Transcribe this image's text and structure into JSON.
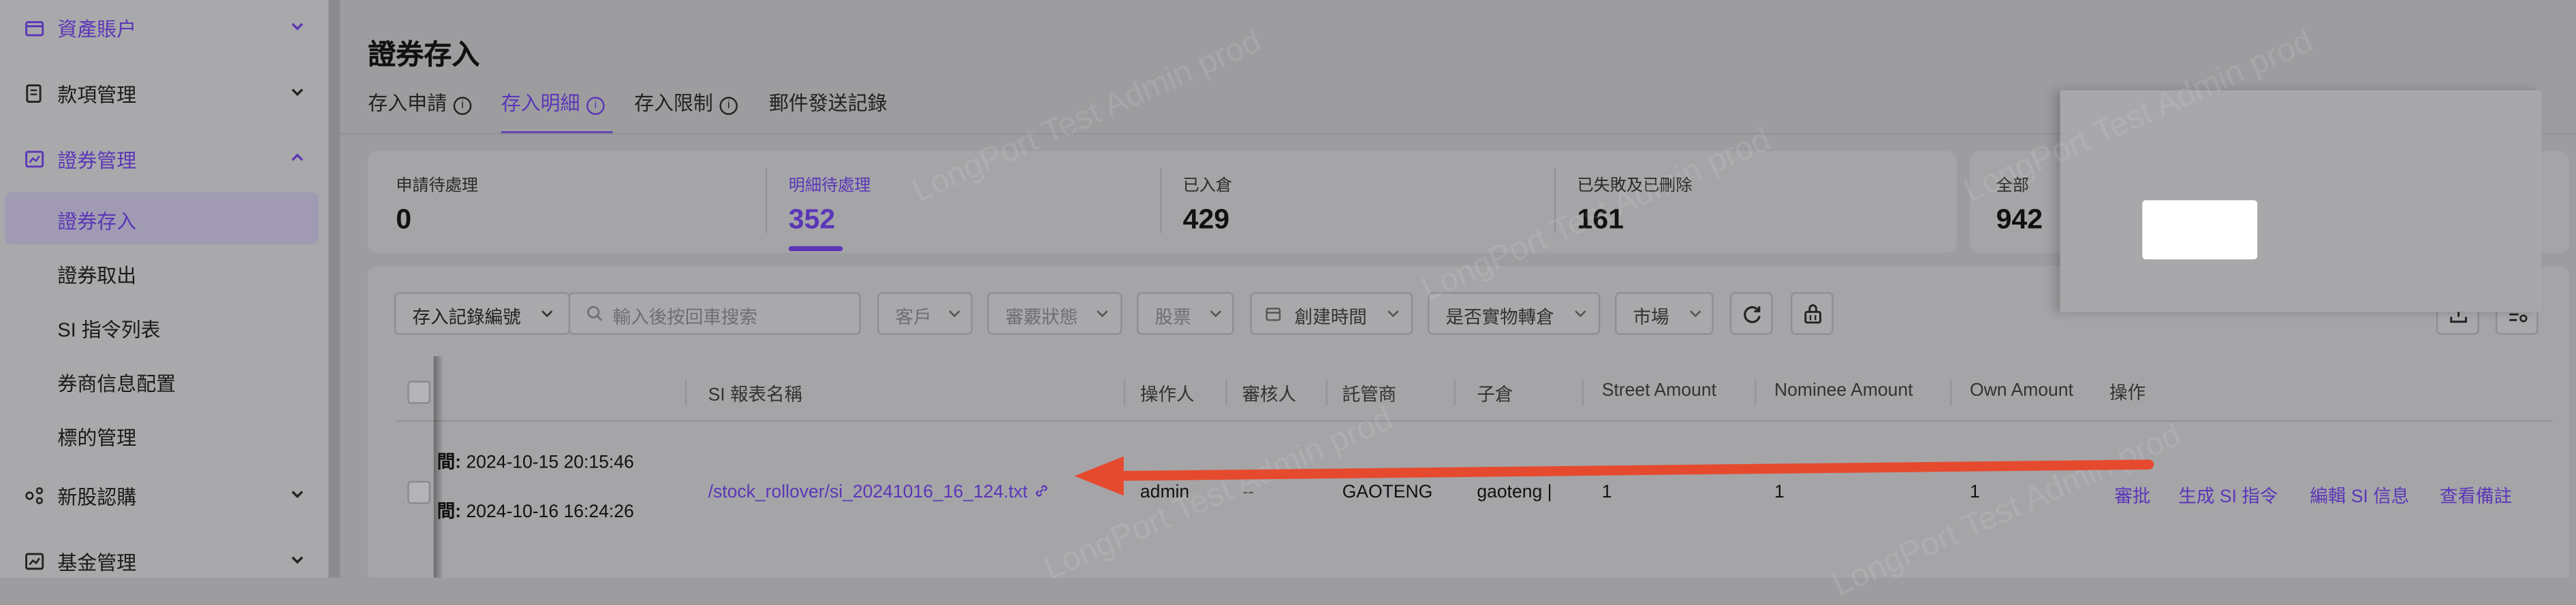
{
  "colors": {
    "accent": "#5b36b7",
    "arrow": "#e64a2e",
    "overlay": "#9d9da0"
  },
  "sidebar": {
    "items": [
      {
        "label": "資產賬户",
        "icon": "wallet-icon",
        "expanded": false
      },
      {
        "label": "款項管理",
        "icon": "ledger-icon",
        "expanded": false
      },
      {
        "label": "證券管理",
        "icon": "chart-icon",
        "expanded": true
      }
    ],
    "sub_items": [
      {
        "label": "證券存入",
        "active": true
      },
      {
        "label": "證券取出"
      },
      {
        "label": "SI 指令列表"
      },
      {
        "label": "券商信息配置"
      },
      {
        "label": "標的管理"
      }
    ],
    "items_after": [
      {
        "label": "新股認購",
        "icon": "share-icon"
      },
      {
        "label": "基金管理",
        "icon": "fund-icon"
      }
    ]
  },
  "page": {
    "title": "證券存入",
    "tabs": [
      {
        "label": "存入申請",
        "info": true
      },
      {
        "label": "存入明細",
        "info": true,
        "active": true
      },
      {
        "label": "存入限制",
        "info": true
      },
      {
        "label": "郵件發送記錄",
        "info": false
      }
    ]
  },
  "stats": [
    {
      "label": "申請待處理",
      "value": "0"
    },
    {
      "label": "明細待處理",
      "value": "352",
      "active": true
    },
    {
      "label": "已入倉",
      "value": "429"
    },
    {
      "label": "已失敗及已刪除",
      "value": "161"
    },
    {
      "label": "全部",
      "value": "942"
    }
  ],
  "filters": {
    "record_select": "存入記錄編號",
    "search_placeholder": "輸入後按回車搜索",
    "client": "客戶",
    "review_status": "審覈狀態",
    "stock": "股票",
    "created_time": "創建時間",
    "physical_transfer": "是否實物轉倉",
    "market": "市場"
  },
  "table": {
    "headers": [
      "SI 報表名稱",
      "操作人",
      "審核人",
      "託管商",
      "子倉",
      "Street Amount",
      "Nominee Amount",
      "Own Amount",
      "操作"
    ],
    "row": {
      "time1_prefix": "間:",
      "time1": "2024-10-15 20:15:46",
      "time2_prefix": "間:",
      "time2": "2024-10-16 16:24:26",
      "si_report": "/stock_rollover/si_20241016_16_124.txt",
      "operator": "admin",
      "reviewer": "--",
      "custodian": "GAOTENG",
      "sub_account": "gaoteng |",
      "street_amount": "1",
      "nominee_amount": "1",
      "own_amount": "1",
      "actions": [
        "審批",
        "生成 SI 指令",
        "編輯 SI 信息",
        "查看備註"
      ]
    }
  },
  "watermark": "LongPort Test Admin prod"
}
